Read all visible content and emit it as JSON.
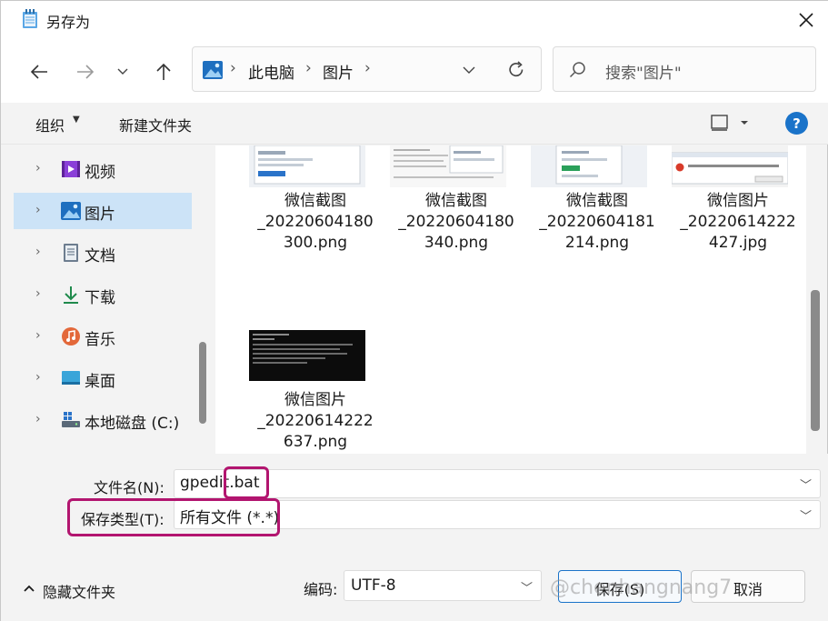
{
  "window": {
    "title": "另存为"
  },
  "nav": {
    "breadcrumb": [
      "此电脑",
      "图片"
    ],
    "search_placeholder": "搜索\"图片\""
  },
  "toolbar": {
    "organize": "组织",
    "new_folder": "新建文件夹",
    "help": "?"
  },
  "sidebar": {
    "items": [
      {
        "label": "视频",
        "icon": "video-icon"
      },
      {
        "label": "图片",
        "icon": "pictures-icon",
        "selected": true
      },
      {
        "label": "文档",
        "icon": "documents-icon"
      },
      {
        "label": "下载",
        "icon": "download-icon"
      },
      {
        "label": "音乐",
        "icon": "music-icon"
      },
      {
        "label": "桌面",
        "icon": "desktop-icon"
      },
      {
        "label": "本地磁盘 (C:)",
        "icon": "drive-icon"
      }
    ]
  },
  "files": [
    {
      "line1": "微信截图",
      "line2": "_20220604180",
      "line3": "300.png"
    },
    {
      "line1": "微信截图",
      "line2": "_20220604180",
      "line3": "340.png"
    },
    {
      "line1": "微信截图",
      "line2": "_20220604181",
      "line3": "214.png"
    },
    {
      "line1": "微信图片",
      "line2": "_20220614222",
      "line3": "427.jpg"
    },
    {
      "line1": "微信图片",
      "line2": "_20220614222",
      "line3": "637.png"
    }
  ],
  "form": {
    "filename_label": "文件名(N):",
    "filename_value": "gpedit.bat",
    "filetype_label": "保存类型(T):",
    "filetype_value": "所有文件 (*.*)",
    "hide_folders": "隐藏文件夹",
    "encoding_label": "编码:",
    "encoding_value": "UTF-8",
    "save_button": "保存(S)",
    "cancel_button": "取消"
  },
  "watermark": "@chenhangnang7",
  "colors": {
    "accent": "#1a73c9",
    "highlight": "#b2156f",
    "selected": "#cce3f7"
  }
}
